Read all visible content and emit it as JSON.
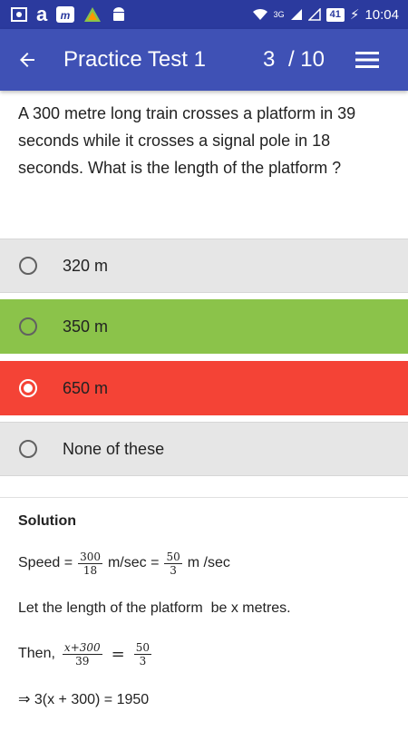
{
  "status_bar": {
    "network": "3G",
    "battery": "41",
    "time": "10:04"
  },
  "app_bar": {
    "title": "Practice Test 1",
    "current_question": "3",
    "total_questions": "/ 10"
  },
  "question": {
    "text": "A 300 metre long train crosses a platform in 39 seconds while it crosses a signal pole in 18 seconds. What is the length of the platform ?"
  },
  "options": [
    {
      "label": "320 m",
      "state": "default"
    },
    {
      "label": "350 m",
      "state": "correct"
    },
    {
      "label": "650 m",
      "state": "wrong-selected"
    },
    {
      "label": "None of these",
      "state": "default"
    }
  ],
  "solution": {
    "heading": "Solution",
    "speed_prefix": "Speed =",
    "speed_f1_num": "300",
    "speed_f1_den": "18",
    "speed_mid": "m/sec =",
    "speed_f2_num": "50",
    "speed_f2_den": "3",
    "speed_suffix": "m /sec",
    "let_line": "Let the length of the platform  be x metres.",
    "then_prefix": "Then,",
    "then_f1_num": "x+300",
    "then_f1_den": "39",
    "then_eq": "=",
    "then_f2_num": "50",
    "then_f2_den": "3",
    "implies_line": "⇒ 3(x + 300) = 1950"
  },
  "colors": {
    "status_bar": "#2b3a9e",
    "app_bar": "#3f51b5",
    "correct": "#8bc34a",
    "wrong": "#f44336",
    "option_bg": "#e6e6e6"
  }
}
